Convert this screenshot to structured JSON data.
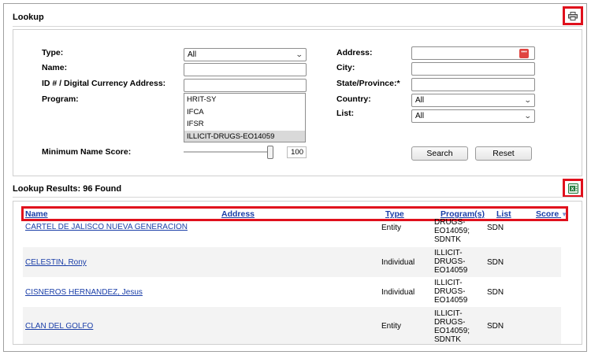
{
  "lookup": {
    "title": "Lookup",
    "fields": {
      "type_label": "Type:",
      "type_value": "All",
      "name_label": "Name:",
      "id_label": "ID # / Digital Currency Address:",
      "program_label": "Program:",
      "min_score_label": "Minimum Name Score:",
      "min_score_value": "100",
      "address_label": "Address:",
      "city_label": "City:",
      "state_label": "State/Province:*",
      "country_label": "Country:",
      "country_value": "All",
      "list_label": "List:",
      "list_value": "All"
    },
    "program_options": [
      "HRIT-SY",
      "IFCA",
      "IFSR",
      "ILLICIT-DRUGS-EO14059"
    ],
    "selected_program": "ILLICIT-DRUGS-EO14059",
    "search_label": "Search",
    "reset_label": "Reset",
    "print_icon": "print-icon",
    "min_score_fraction": 1.0
  },
  "results": {
    "title": "Lookup Results: 96 Found",
    "export_icon": "excel-export-icon",
    "columns": {
      "name": "Name",
      "address": "Address",
      "type": "Type",
      "programs": "Program(s)",
      "list": "List",
      "score": "Score",
      "score_sort_icon": "▼"
    },
    "rows": [
      {
        "name": "CARTEL DE JALISCO NUEVA GENERACION",
        "type": "Entity",
        "programs": "DRUGS-\nEO14059;\nSDNTK",
        "list": "SDN"
      },
      {
        "name": "CELESTIN, Rony",
        "type": "Individual",
        "programs": "ILLICIT-\nDRUGS-\nEO14059",
        "list": "SDN"
      },
      {
        "name": "CISNEROS HERNANDEZ, Jesus",
        "type": "Individual",
        "programs": "ILLICIT-\nDRUGS-\nEO14059",
        "list": "SDN"
      },
      {
        "name": "CLAN DEL GOLFO",
        "type": "Entity",
        "programs": "ILLICIT-\nDRUGS-\nEO14059;\nSDNTK",
        "list": "SDN"
      }
    ]
  },
  "colors": {
    "highlight": "#e0101c",
    "link": "#1a3ea8"
  }
}
